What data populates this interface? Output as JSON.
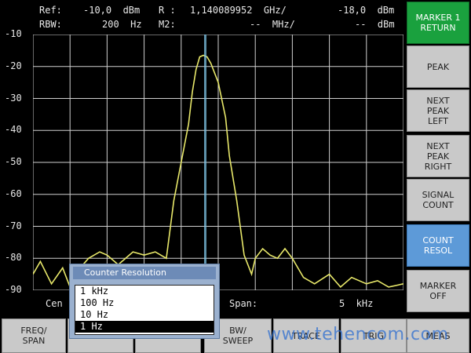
{
  "header": {
    "ref_label": "Ref:",
    "ref_value": "-10,0  dBm",
    "r_label": "R :",
    "r_value": "1,140089952  GHz/",
    "r_level": "-18,0  dBm",
    "rbw_label": "RBW:",
    "rbw_value": "200  Hz",
    "m2_label": "M2:",
    "m2_value": "--  MHz/",
    "m2_level": "--  dBm"
  },
  "y_axis": [
    "-10",
    "-20",
    "-30",
    "-40",
    "-50",
    "-60",
    "-70",
    "-80",
    "-90"
  ],
  "softkeys": [
    {
      "label": "MARKER 1\nRETURN",
      "state": "active-green"
    },
    {
      "label": "PEAK",
      "state": "normal"
    },
    {
      "label": "NEXT\nPEAK\nLEFT",
      "state": "normal"
    },
    {
      "label": "NEXT\nPEAK\nRIGHT",
      "state": "normal"
    },
    {
      "label": "SIGNAL\nCOUNT",
      "state": "normal"
    },
    {
      "label": "COUNT\nRESOL",
      "state": "active-blue"
    },
    {
      "label": "MARKER\nOFF",
      "state": "normal"
    }
  ],
  "bottom_tabs": [
    "FREQ/\nSPAN",
    "",
    "",
    "BW/\nSWEEP",
    "TRACE",
    "TRIG",
    "MEAS"
  ],
  "status": {
    "center_label": "Cen",
    "span_label": "Span:",
    "span_value": "5  kHz"
  },
  "popup": {
    "title": "Counter Resolution",
    "options": [
      "1  kHz",
      "100  Hz",
      "10  Hz",
      "1  Hz"
    ],
    "selected_index": 3
  },
  "watermark": "www.tehencom.com",
  "chart_data": {
    "type": "line",
    "ylim": [
      -90,
      -10
    ],
    "yticks": [
      -10,
      -20,
      -30,
      -40,
      -50,
      -60,
      -70,
      -80,
      -90
    ],
    "series": [
      {
        "x": [
          0,
          0.02,
          0.05,
          0.08,
          0.1,
          0.12,
          0.15,
          0.18,
          0.2,
          0.23,
          0.27,
          0.3,
          0.33,
          0.36,
          0.38,
          0.4,
          0.42,
          0.43,
          0.44,
          0.45,
          0.46,
          0.47,
          0.48,
          0.5,
          0.52,
          0.53,
          0.55,
          0.57,
          0.59,
          0.6,
          0.62,
          0.64,
          0.66,
          0.68,
          0.7,
          0.73,
          0.76,
          0.8,
          0.83,
          0.86,
          0.9,
          0.93,
          0.96,
          1.0
        ],
        "y": [
          -85,
          -81,
          -88,
          -83,
          -89,
          -84,
          -80,
          -78,
          -79,
          -82,
          -78,
          -79,
          -78,
          -80,
          -62,
          -50,
          -38,
          -28,
          -21,
          -17,
          -16.5,
          -17,
          -19,
          -25,
          -36,
          -48,
          -62,
          -79,
          -85,
          -80,
          -77,
          -79,
          -80,
          -77,
          -80,
          -86,
          -88,
          -85,
          -89,
          -86,
          -88,
          -87,
          -89,
          -88
        ],
        "color": "#e8e86a"
      }
    ],
    "marker_x": 0.465,
    "grid": true
  }
}
